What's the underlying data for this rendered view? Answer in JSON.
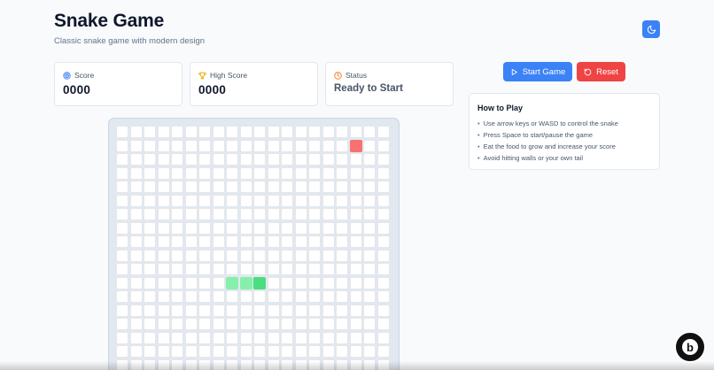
{
  "header": {
    "title": "Snake Game",
    "subtitle": "Classic snake game with modern design"
  },
  "theme_toggle": {
    "icon": "moon-icon"
  },
  "stats": {
    "score": {
      "label": "Score",
      "value": "0000",
      "icon": "target-icon"
    },
    "high_score": {
      "label": "High Score",
      "value": "0000",
      "icon": "trophy-icon"
    },
    "status": {
      "label": "Status",
      "value": "Ready to Start",
      "icon": "clock-icon"
    }
  },
  "controls": {
    "start_label": "Start Game",
    "reset_label": "Reset"
  },
  "how_to": {
    "title": "How to Play",
    "items": [
      "Use arrow keys or WASD to control the snake",
      "Press Space to start/pause the game",
      "Eat the food to grow and increase your score",
      "Avoid hitting walls or your own tail"
    ]
  },
  "board": {
    "columns": 20,
    "rows_visible": 19,
    "snake": [
      [
        8,
        11
      ],
      [
        9,
        11
      ],
      [
        10,
        11
      ]
    ],
    "snake_head": [
      10,
      11
    ],
    "food": [
      17,
      1
    ]
  },
  "colors": {
    "accent": "#3b82f6",
    "danger": "#ef4444",
    "snake": "#86efac",
    "snake_head": "#4ade80",
    "food": "#f87171"
  },
  "badge": {
    "text": "b",
    "icon": "badge-logo-icon"
  }
}
